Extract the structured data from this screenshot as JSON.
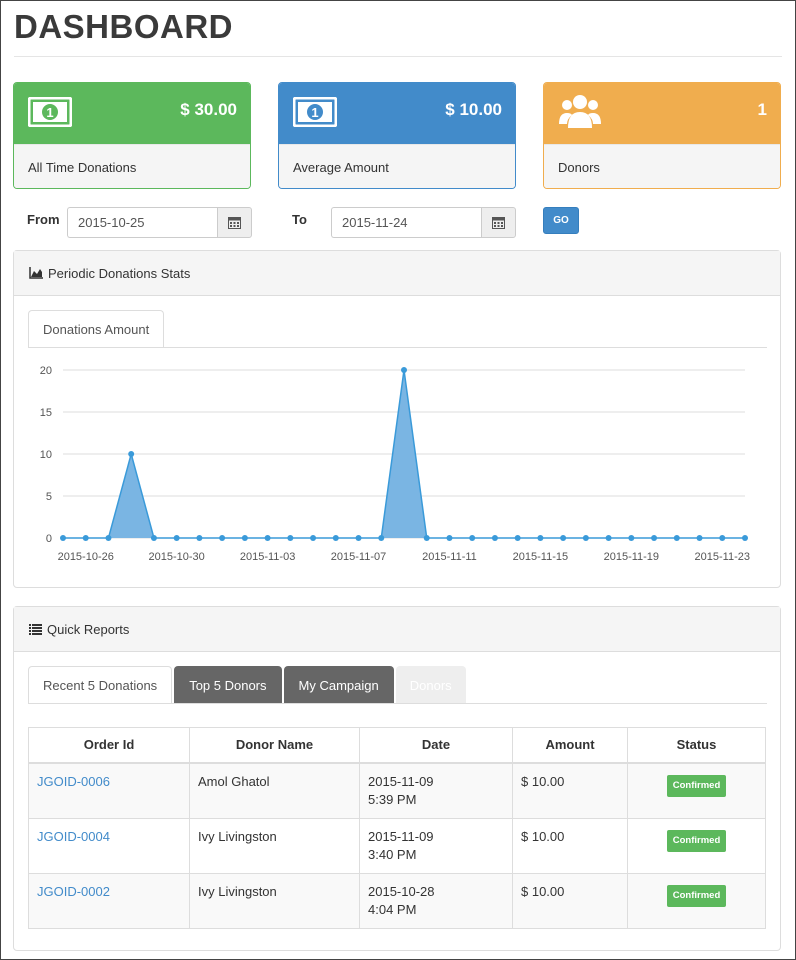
{
  "page": {
    "title": "DASHBOARD"
  },
  "cards": [
    {
      "value": "$ 30.00",
      "label": "All Time Donations",
      "icon": "money-icon",
      "color": "#5cb85c"
    },
    {
      "value": "$ 10.00",
      "label": "Average Amount",
      "icon": "money-icon",
      "color": "#428bca"
    },
    {
      "value": "1",
      "label": "Donors",
      "icon": "users-icon",
      "color": "#f0ad4e"
    }
  ],
  "filters": {
    "from_label": "From",
    "from_value": "2015-10-25",
    "to_label": "To",
    "to_value": "2015-11-24",
    "go_label": "GO",
    "calendar_icon": "calendar-icon"
  },
  "stats_panel": {
    "title": "Periodic Donations Stats",
    "icon": "area-chart-icon",
    "tab_label": "Donations Amount"
  },
  "chart_data": {
    "type": "area",
    "x_start": "2015-10-25",
    "x_end": "2015-11-24",
    "x_tick_labels": [
      "2015-10-26",
      "2015-10-30",
      "2015-11-03",
      "2015-11-07",
      "2015-11-11",
      "2015-11-15",
      "2015-11-19",
      "2015-11-23"
    ],
    "y_ticks": [
      0,
      5,
      10,
      15,
      20
    ],
    "ylim": [
      0,
      20
    ],
    "grid": true,
    "series": [
      {
        "values": [
          0,
          0,
          0,
          10,
          0,
          0,
          0,
          0,
          0,
          0,
          0,
          0,
          0,
          0,
          0,
          20,
          0,
          0,
          0,
          0,
          0,
          0,
          0,
          0,
          0,
          0,
          0,
          0,
          0,
          0,
          0
        ],
        "color": "#3a9ad9"
      }
    ]
  },
  "reports_panel": {
    "title": "Quick Reports",
    "icon": "list-icon",
    "tabs": [
      {
        "label": "Recent 5 Donations"
      },
      {
        "label": "Top 5 Donors"
      },
      {
        "label": "My Campaign"
      },
      {
        "label": "Donors"
      }
    ],
    "columns": [
      "Order Id",
      "Donor Name",
      "Date",
      "Amount",
      "Status"
    ],
    "rows": [
      {
        "order_id": "JGOID-0006",
        "donor": "Amol Ghatol",
        "date": "2015-11-09",
        "time": "5:39 PM",
        "amount": "$ 10.00",
        "status": "Confirmed"
      },
      {
        "order_id": "JGOID-0004",
        "donor": "Ivy Livingston",
        "date": "2015-11-09",
        "time": "3:40 PM",
        "amount": "$ 10.00",
        "status": "Confirmed"
      },
      {
        "order_id": "JGOID-0002",
        "donor": "Ivy Livingston",
        "date": "2015-10-28",
        "time": "4:04 PM",
        "amount": "$ 10.00",
        "status": "Confirmed"
      }
    ]
  }
}
